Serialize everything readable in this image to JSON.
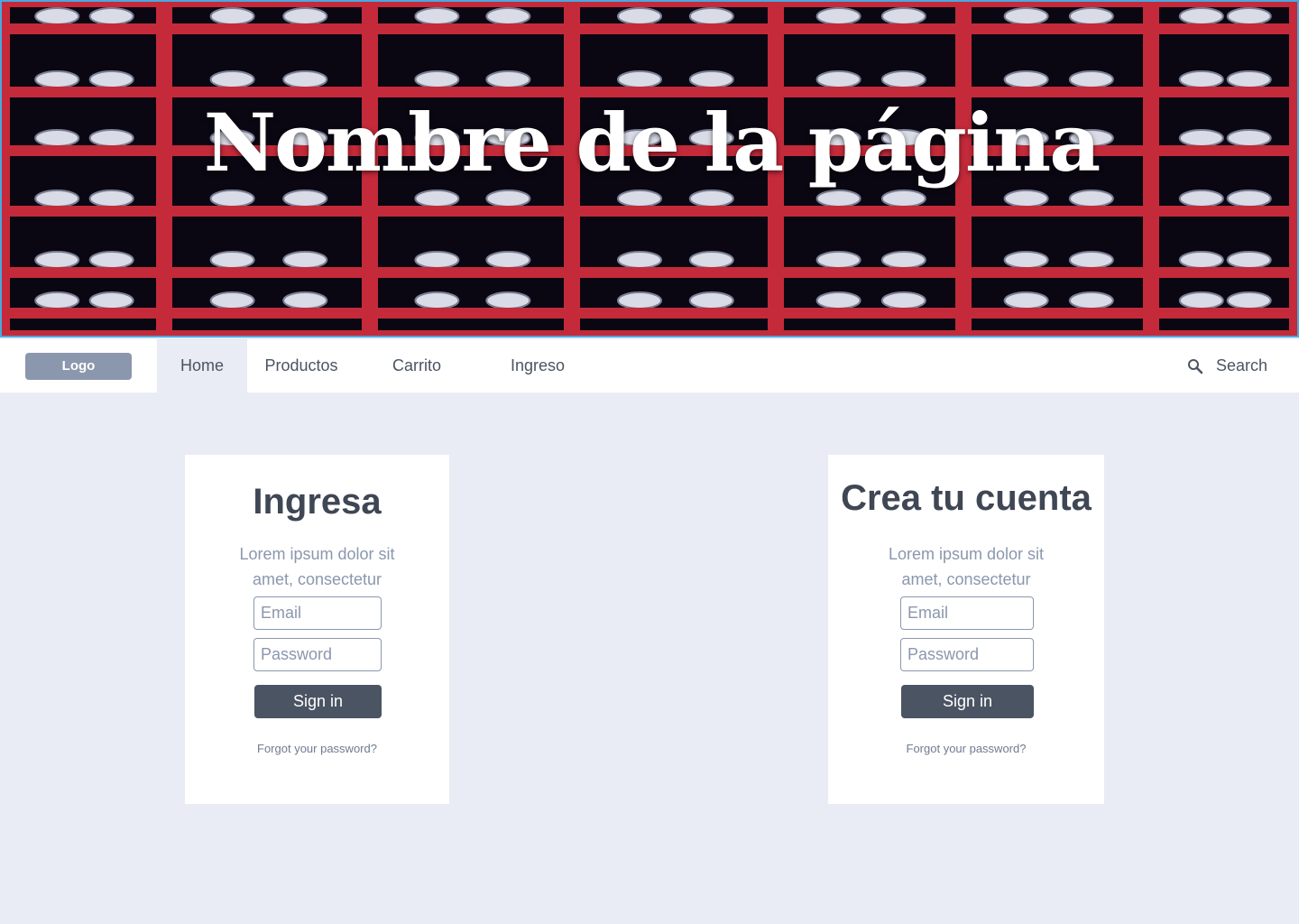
{
  "hero": {
    "title": "Nombre de la página"
  },
  "nav": {
    "logo": "Logo",
    "items": [
      {
        "label": "Home"
      },
      {
        "label": "Productos"
      },
      {
        "label": "Carrito"
      },
      {
        "label": "Ingreso"
      }
    ],
    "search_label": "Search",
    "search_icon": "search-icon"
  },
  "login": {
    "title": "Ingresa",
    "description": "Lorem ipsum dolor sit amet, consectetur",
    "email_placeholder": "Email",
    "password_placeholder": "Password",
    "button_label": "Sign in",
    "forgot_label": "Forgot your password?"
  },
  "register": {
    "title": "Crea tu cuenta",
    "description": "Lorem ipsum dolor sit amet, consectetur",
    "email_placeholder": "Email",
    "password_placeholder": "Password",
    "button_label": "Sign in",
    "forgot_label": "Forgot your password?"
  },
  "colors": {
    "page_background": "#e9ecf4",
    "shelf_red": "#c42a3a",
    "button_dark": "#4b5463",
    "logo_gray": "#8b97ad",
    "hero_border": "#4aa8e0"
  }
}
